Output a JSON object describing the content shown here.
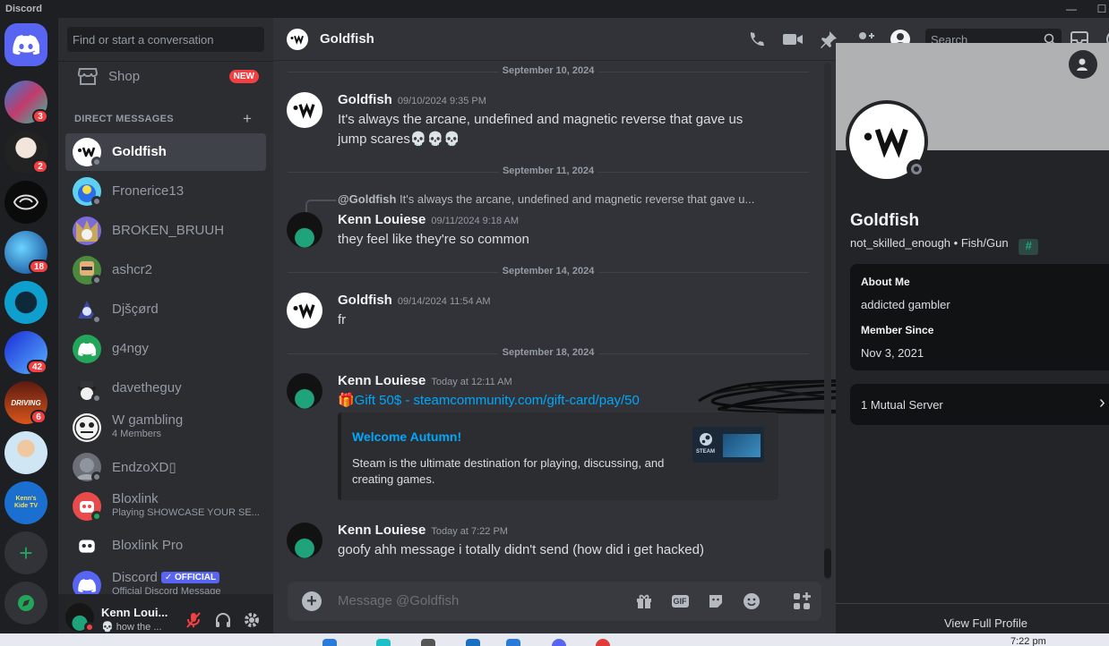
{
  "window": {
    "app_name": "Discord",
    "minimize": "—",
    "maximize": "☐"
  },
  "servers": [
    {
      "name": "server-1",
      "badge": "3"
    },
    {
      "name": "server-2",
      "badge": "2"
    },
    {
      "name": "server-3",
      "badge": ""
    },
    {
      "name": "server-4",
      "badge": "18"
    },
    {
      "name": "server-5",
      "badge": ""
    },
    {
      "name": "server-6",
      "badge": "42"
    },
    {
      "name": "server-7",
      "badge": "6",
      "label": "DRIVING"
    },
    {
      "name": "server-8",
      "badge": ""
    },
    {
      "name": "server-9",
      "badge": "",
      "label": "Kenn's Kide TV"
    }
  ],
  "sidebar": {
    "search_placeholder": "Find or start a conversation",
    "shop_label": "Shop",
    "shop_badge": "NEW",
    "dm_header": "DIRECT MESSAGES",
    "dm_add": "+",
    "dms": [
      {
        "name": "Goldfish",
        "sub": ""
      },
      {
        "name": "Fronerice13",
        "sub": ""
      },
      {
        "name": "BROKEN_BRUUH",
        "sub": ""
      },
      {
        "name": "ashcr2",
        "sub": ""
      },
      {
        "name": "Djšçørd",
        "sub": ""
      },
      {
        "name": "g4ngy",
        "sub": ""
      },
      {
        "name": "davetheguy",
        "sub": ""
      },
      {
        "name": "W gambling",
        "sub": "4 Members"
      },
      {
        "name": "EndzoXD▯",
        "sub": ""
      },
      {
        "name": "Bloxlink",
        "sub": "Playing SHOWCASE YOUR SE..."
      },
      {
        "name": "Bloxlink Pro",
        "sub": ""
      },
      {
        "name": "Discord",
        "sub": "Official Discord Message",
        "tag": "OFFICIAL"
      }
    ]
  },
  "user_panel": {
    "name": "Kenn Loui...",
    "status": "how the ..."
  },
  "chat": {
    "channel_name": "Goldfish",
    "search_placeholder": "Search",
    "composer_placeholder": "Message @Goldfish",
    "gif_label": "GIF",
    "dividers": [
      "September 10, 2024",
      "September 11, 2024",
      "September 14, 2024",
      "September 18, 2024"
    ],
    "messages": [
      {
        "author": "Goldfish",
        "time": "09/10/2024 9:35 PM",
        "text": "It's always the arcane, undefined and magnetic reverse that gave us jump scares💀💀💀"
      },
      {
        "author": "Kenn Louiese",
        "time": "09/11/2024 9:18 AM",
        "reply_to": "@Goldfish",
        "reply_text": "It's always the arcane, undefined and magnetic reverse that gave u...",
        "text": "they feel like they're so common"
      },
      {
        "author": "Goldfish",
        "time": "09/14/2024 11:54 AM",
        "text": "fr"
      },
      {
        "author": "Kenn Louiese",
        "time": "Today at 12:11 AM",
        "text": "🎁Gift 50$ - steamcommunity.com/gift-card/pay/50"
      },
      {
        "author": "Kenn Louiese",
        "time": "Today at 7:22 PM",
        "text": "goofy ahh message i totally didn't send (how did i get hacked)"
      }
    ],
    "embed": {
      "title": "Welcome Autumn!",
      "description": "Steam is the ultimate destination for playing, discussing, and creating games.",
      "thumb_label": "STEAM"
    }
  },
  "profile": {
    "display_name": "Goldfish",
    "username": "not_skilled_enough",
    "pronouns": "Fish/Gun",
    "badge": "#",
    "about_header": "About Me",
    "about_text": "addicted gambler",
    "member_header": "Member Since",
    "member_since": "Nov 3, 2021",
    "mutual": "1 Mutual Server",
    "view_full": "View Full Profile"
  },
  "taskbar": {
    "clock": "7:22 pm"
  },
  "colors": {
    "blurple": "#5865f2",
    "red": "#f23f43",
    "green": "#23a55a",
    "link": "#00a8fc"
  }
}
